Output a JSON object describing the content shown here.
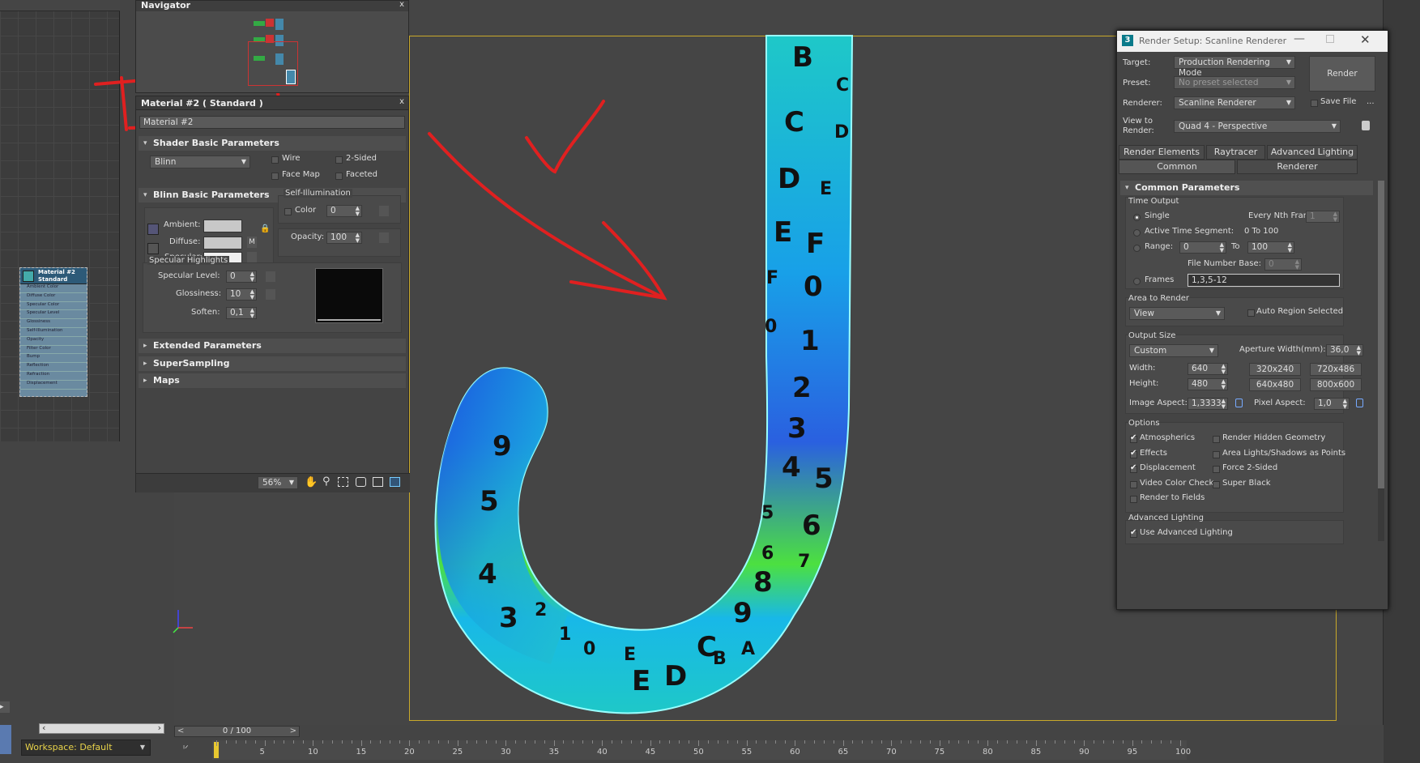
{
  "navigator": {
    "title": "Navigator",
    "close": "x"
  },
  "material": {
    "header": "Material #2  ( Standard )",
    "close": "x",
    "name": "Material #2",
    "shader_rollout": "Shader Basic Parameters",
    "shader_value": "Blinn",
    "wire": "Wire",
    "two_sided": "2-Sided",
    "face_map": "Face Map",
    "faceted": "Faceted",
    "blinn_rollout": "Blinn Basic Parameters",
    "ambient": "Ambient:",
    "diffuse": "Diffuse:",
    "specular": "Specular:",
    "map_m": "M",
    "self_illum": "Self-Illumination",
    "color": "Color",
    "color_val": "0",
    "opacity": "Opacity:",
    "opacity_val": "100",
    "spec_highlights": "Specular Highlights",
    "spec_level": "Specular Level:",
    "spec_level_val": "0",
    "glossiness": "Glossiness:",
    "glossiness_val": "10",
    "soften": "Soften:",
    "soften_val": "0,1",
    "extended": "Extended Parameters",
    "supersampling": "SuperSampling",
    "maps": "Maps",
    "zoom": "56%"
  },
  "node": {
    "title1": "Material #2",
    "title2": "Standard",
    "slots": [
      "Ambient Color",
      "Diffuse Color",
      "Specular Color",
      "Specular Level",
      "Glossiness",
      "Self-Illumination",
      "Opacity",
      "Filter Color",
      "Bump",
      "Reflection",
      "Refraction",
      "Displacement"
    ]
  },
  "workspace": "Workspace: Default",
  "timeline": {
    "frame": "0 / 100",
    "ticks": [
      "5",
      "10",
      "15",
      "20",
      "25",
      "30",
      "35",
      "40",
      "45",
      "50",
      "55",
      "60",
      "65",
      "70",
      "75",
      "80",
      "85",
      "90",
      "95",
      "100"
    ]
  },
  "render": {
    "title": "Render Setup: Scanline Renderer",
    "target_label": "Target:",
    "target": "Production Rendering Mode",
    "preset_label": "Preset:",
    "preset": "No preset selected",
    "renderer_label": "Renderer:",
    "renderer": "Scanline Renderer",
    "save_file": "Save File",
    "more": "...",
    "view_label1": "View to",
    "view_label2": "Render:",
    "view": "Quad 4 - Perspective",
    "render_btn": "Render",
    "tabs_row1": [
      "Render Elements",
      "Raytracer",
      "Advanced Lighting"
    ],
    "tabs_row2": [
      "Common",
      "Renderer"
    ],
    "common_params": "Common Parameters",
    "time_output": "Time Output",
    "single": "Single",
    "every_nth": "Every Nth Frame:",
    "every_nth_val": "1",
    "active_segment": "Active Time Segment:",
    "active_range": "0 To 100",
    "range": "Range:",
    "range_from": "0",
    "range_to_label": "To",
    "range_to": "100",
    "file_number_base": "File Number Base:",
    "file_number_val": "0",
    "frames": "Frames",
    "frames_val": "1,3,5-12",
    "area_to_render": "Area to Render",
    "area_val": "View",
    "auto_region": "Auto Region Selected",
    "output_size": "Output Size",
    "size_preset": "Custom",
    "aperture": "Aperture Width(mm):",
    "aperture_val": "36,0",
    "width": "Width:",
    "width_val": "640",
    "height": "Height:",
    "height_val": "480",
    "presets": [
      "320x240",
      "720x486",
      "640x480",
      "800x600"
    ],
    "image_aspect": "Image Aspect:",
    "image_aspect_val": "1,3333",
    "pixel_aspect": "Pixel Aspect:",
    "pixel_aspect_val": "1,0",
    "options": "Options",
    "opt_left": [
      {
        "label": "Atmospherics",
        "on": true
      },
      {
        "label": "Effects",
        "on": true
      },
      {
        "label": "Displacement",
        "on": true
      },
      {
        "label": "Video Color Check",
        "on": false
      },
      {
        "label": "Render to Fields",
        "on": false
      }
    ],
    "opt_right": [
      {
        "label": "Render Hidden Geometry",
        "on": false
      },
      {
        "label": "Area Lights/Shadows as Points",
        "on": false
      },
      {
        "label": "Force 2-Sided",
        "on": false
      },
      {
        "label": "Super Black",
        "on": false
      }
    ],
    "adv_lighting": "Advanced Lighting",
    "use_adv": "Use Advanced Lighting"
  },
  "colors": {
    "annotation": "#e02020",
    "viewport_bg": "#454545",
    "panel": "#444444"
  }
}
